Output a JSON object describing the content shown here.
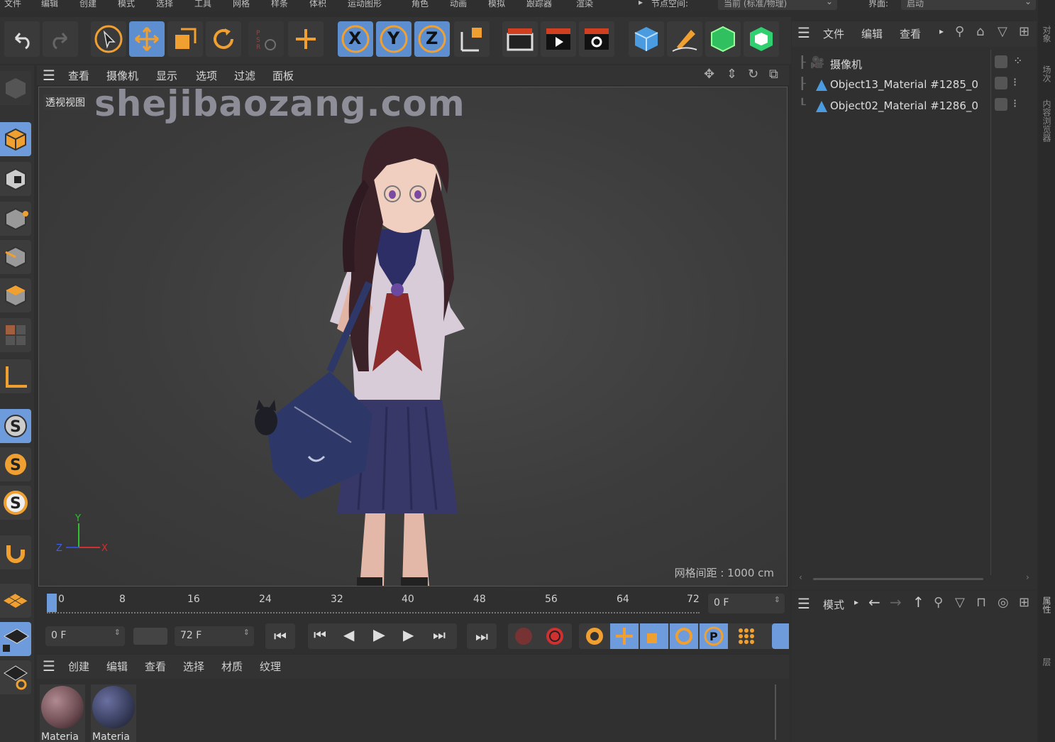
{
  "menu": {
    "items": [
      "文件",
      "编辑",
      "创建",
      "模式",
      "选择",
      "工具",
      "网格",
      "样条",
      "体积",
      "运动图形",
      "角色",
      "动画",
      "模拟",
      "跟踪器",
      "渲染"
    ],
    "node_space_label": "节点空间:",
    "node_space_value": "当前 (标准/物理)",
    "interface_label": "界面:",
    "interface_value": "启动"
  },
  "toolbar": {
    "axis_x": "X",
    "axis_y": "Y",
    "axis_z": "Z"
  },
  "viewport": {
    "menu": [
      "查看",
      "摄像机",
      "显示",
      "选项",
      "过滤",
      "面板"
    ],
    "view_label": "透视视图",
    "watermark": "shejibaozang.com",
    "grid_spacing": "网格间距 : 1000 cm",
    "axis_labels": {
      "x": "X",
      "y": "Y",
      "z": "Z"
    }
  },
  "timeline": {
    "ticks": [
      "0",
      "8",
      "16",
      "24",
      "32",
      "40",
      "48",
      "56",
      "64",
      "72"
    ],
    "current_frame": "0 F",
    "start_frame": "0 F",
    "end_frame": "72 F"
  },
  "material_menu": [
    "创建",
    "编辑",
    "查看",
    "选择",
    "材质",
    "纹理"
  ],
  "materials": [
    {
      "label": "Materia",
      "color": "#6a4a50"
    },
    {
      "label": "Materia",
      "color": "#3a4060"
    }
  ],
  "object_manager": {
    "menu": [
      "文件",
      "编辑",
      "查看"
    ],
    "items": [
      {
        "name": "摄像机"
      },
      {
        "name": "Object13_Material #1285_0"
      },
      {
        "name": "Object02_Material #1286_0"
      }
    ]
  },
  "attribute_manager": {
    "mode_label": "模式"
  },
  "right_strip": [
    "对象",
    "场次",
    "内容浏览器",
    "属性",
    "层"
  ],
  "colors": {
    "accent_orange": "#f0a030",
    "selected_blue": "#6d9bdc"
  }
}
